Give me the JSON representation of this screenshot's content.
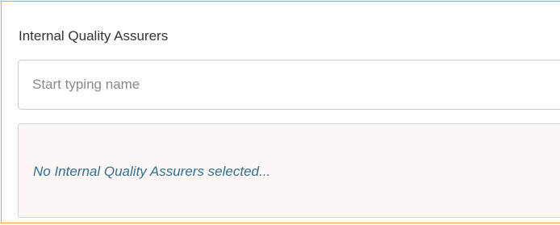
{
  "section": {
    "label": "Internal Quality Assurers"
  },
  "search": {
    "value": "",
    "placeholder": "Start typing name"
  },
  "selection": {
    "empty_message": "No Internal Quality Assurers selected..."
  },
  "colors": {
    "panel_border": "#f0a050",
    "empty_box_background": "#fcf6f5",
    "empty_message_text": "#31708f"
  }
}
